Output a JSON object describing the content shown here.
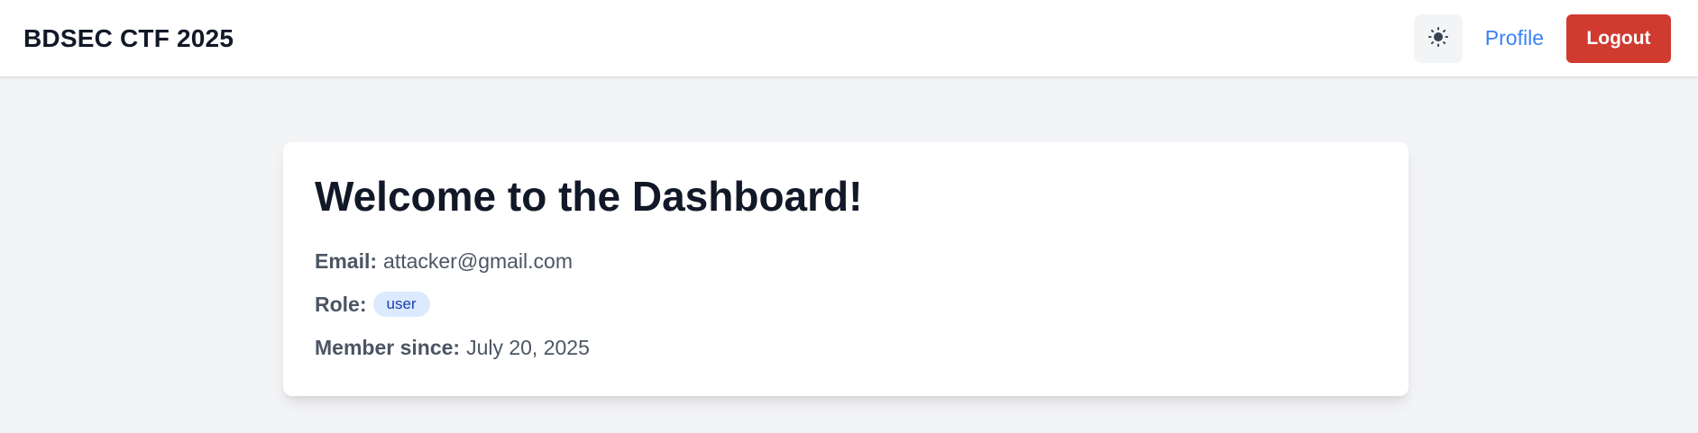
{
  "navbar": {
    "brand": "BDSEC CTF 2025",
    "theme_toggle_icon": "sun-icon",
    "profile_label": "Profile",
    "logout_label": "Logout"
  },
  "dashboard": {
    "title": "Welcome to the Dashboard!",
    "email_label": "Email:",
    "email_value": "attacker@gmail.com",
    "role_label": "Role:",
    "role_value": "user",
    "member_since_label": "Member since:",
    "member_since_value": "July 20, 2025"
  },
  "colors": {
    "logout_bg": "#d03a2f",
    "link": "#3b82f6",
    "badge_bg": "#dbeafe",
    "badge_text": "#1e40af",
    "page_bg": "#f3f4f6"
  }
}
